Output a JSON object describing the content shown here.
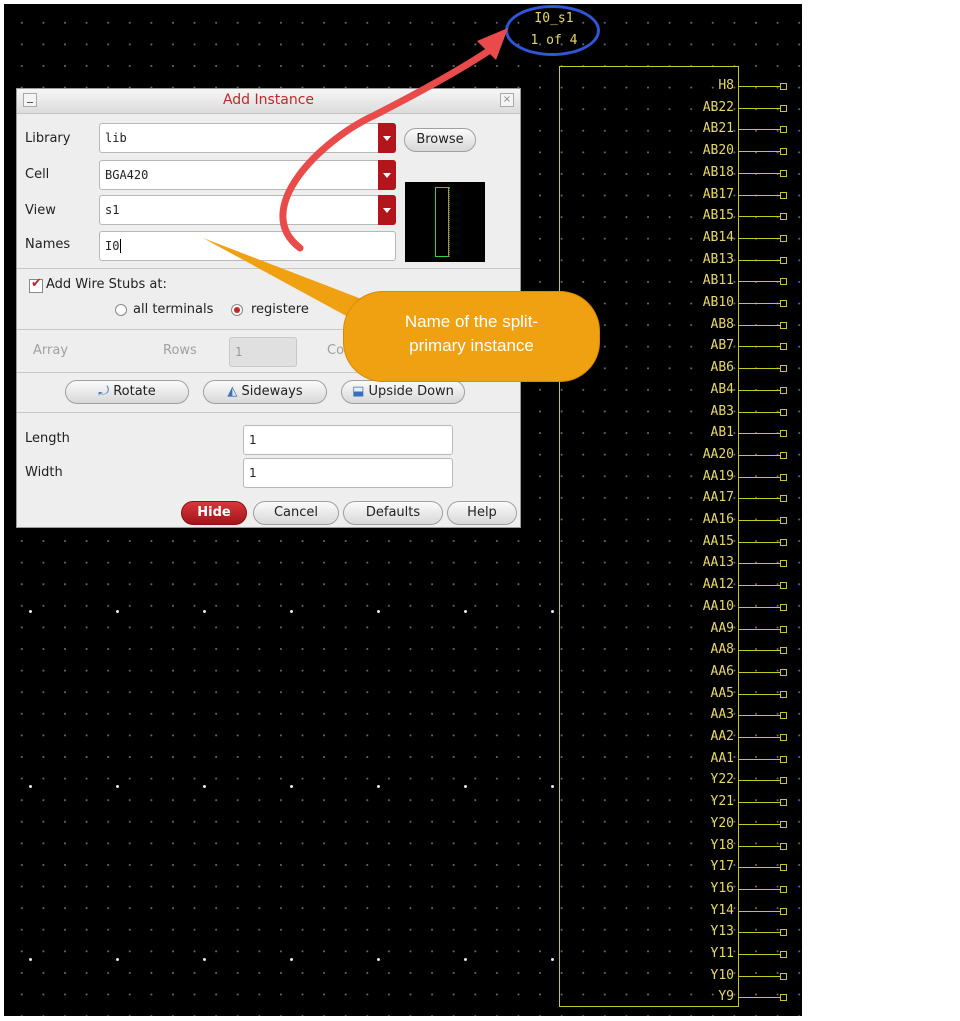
{
  "instance_label": {
    "name": "I0_s1",
    "part": "1 of 4"
  },
  "symbol": {
    "pins": [
      "H8",
      "AB22",
      "AB21",
      "AB20",
      "AB18",
      "AB17",
      "AB15",
      "AB14",
      "AB13",
      "AB11",
      "AB10",
      "AB8",
      "AB7",
      "AB6",
      "AB4",
      "AB3",
      "AB1",
      "AA20",
      "AA19",
      "AA17",
      "AA16",
      "AA15",
      "AA13",
      "AA12",
      "AA10",
      "AA9",
      "AA8",
      "AA6",
      "AA5",
      "AA3",
      "AA2",
      "AA1",
      "Y22",
      "Y21",
      "Y20",
      "Y18",
      "Y17",
      "Y16",
      "Y14",
      "Y13",
      "Y11",
      "Y10",
      "Y9"
    ]
  },
  "dialog": {
    "title": "Add Instance",
    "library_label": "Library",
    "library_value": "lib",
    "browse_label": "Browse",
    "cell_label": "Cell",
    "cell_value": "BGA420",
    "view_label": "View",
    "view_value": "s1",
    "names_label": "Names",
    "names_value": "I0",
    "wire_stubs_label": "Add Wire Stubs at:",
    "wire_stubs_checked": true,
    "radio_all_label": "all terminals",
    "radio_registered_label": "registere",
    "array_label": "Array",
    "rows_label": "Rows",
    "rows_value": "1",
    "columns_label": "Co",
    "rotate_label": "Rotate",
    "sideways_label": "Sideways",
    "upside_down_label": "Upside Down",
    "length_label": "Length",
    "length_value": "1",
    "width_label": "Width",
    "width_value": "1",
    "hide_label": "Hide",
    "cancel_label": "Cancel",
    "defaults_label": "Defaults",
    "help_label": "Help"
  },
  "callout": {
    "line1": "Name of the split-",
    "line2": "primary instance"
  },
  "colors": {
    "canvas": "#000000",
    "symbol_yellow": "#e8d860",
    "highlight_circle": "#2f56d8",
    "arrow": "#e94b4b",
    "callout": "#f0a111",
    "accent_red": "#b2161c"
  }
}
